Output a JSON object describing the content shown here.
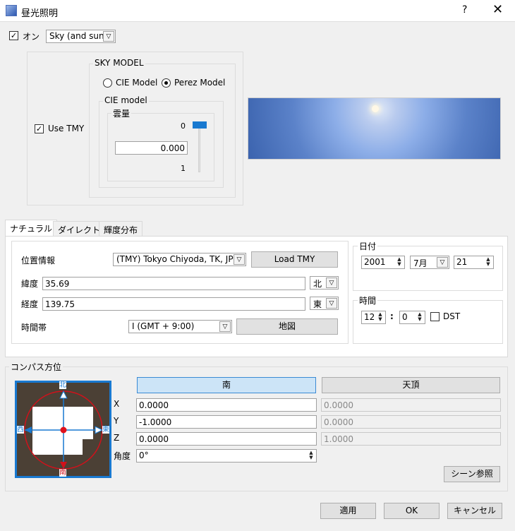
{
  "window": {
    "title": "昼光照明",
    "help_glyph": "?",
    "close_glyph": "✕"
  },
  "top": {
    "on_label": "オン",
    "on_checked": true,
    "sky_type": "Sky (and sun)"
  },
  "sky_model": {
    "use_tmy_label": "Use TMY",
    "use_tmy_checked": true,
    "group_label": "SKY MODEL",
    "cie_label": "CIE Model",
    "perez_label": "Perez Model",
    "selected": "Perez Model",
    "cie_group_label": "CIE model",
    "cloud_group_label": "雲量",
    "cloud_min": "0",
    "cloud_max": "1",
    "cloud_value": "0.000"
  },
  "tabs": [
    {
      "label": "ナチュラル",
      "active": true
    },
    {
      "label": "ダイレクト",
      "active": false
    },
    {
      "label": "輝度分布",
      "active": false
    }
  ],
  "location": {
    "label": "位置情報",
    "value": "(TMY) Tokyo Chiyoda, TK, JPN",
    "load_label": "Load TMY",
    "lat_label": "緯度",
    "lat_value": "35.69",
    "lat_dir": "北",
    "lon_label": "経度",
    "lon_value": "139.75",
    "lon_dir": "東",
    "tz_label": "時間帯",
    "tz_value": "I (GMT + 9:00)",
    "map_label": "地図"
  },
  "date": {
    "group_label": "日付",
    "year": "2001",
    "month": "7月",
    "day": "21"
  },
  "time": {
    "group_label": "時間",
    "hour": "12",
    "sep": ":",
    "minute": "0",
    "dst_label": "DST",
    "dst_checked": false
  },
  "compass": {
    "group_label": "コンパス方位",
    "labels": {
      "n": "北",
      "w": "西",
      "e": "東",
      "s": "南"
    },
    "south_btn": "南",
    "zenith_btn": "天頂",
    "x_label": "X",
    "y_label": "Y",
    "z_label": "Z",
    "angle_label": "角度",
    "x1": "0.0000",
    "y1": "-1.0000",
    "z1": "0.0000",
    "x2": "0.0000",
    "y2": "0.0000",
    "z2": "1.0000",
    "angle": "0°",
    "scene_ref": "シーン参照"
  },
  "footer": {
    "apply": "適用",
    "ok": "OK",
    "cancel": "キャンセル"
  },
  "colors": {
    "accent": "#1979d0",
    "selected_btn": "#cce4f7",
    "compass_bg": "#4b4035",
    "compass_red": "#d0111b"
  }
}
